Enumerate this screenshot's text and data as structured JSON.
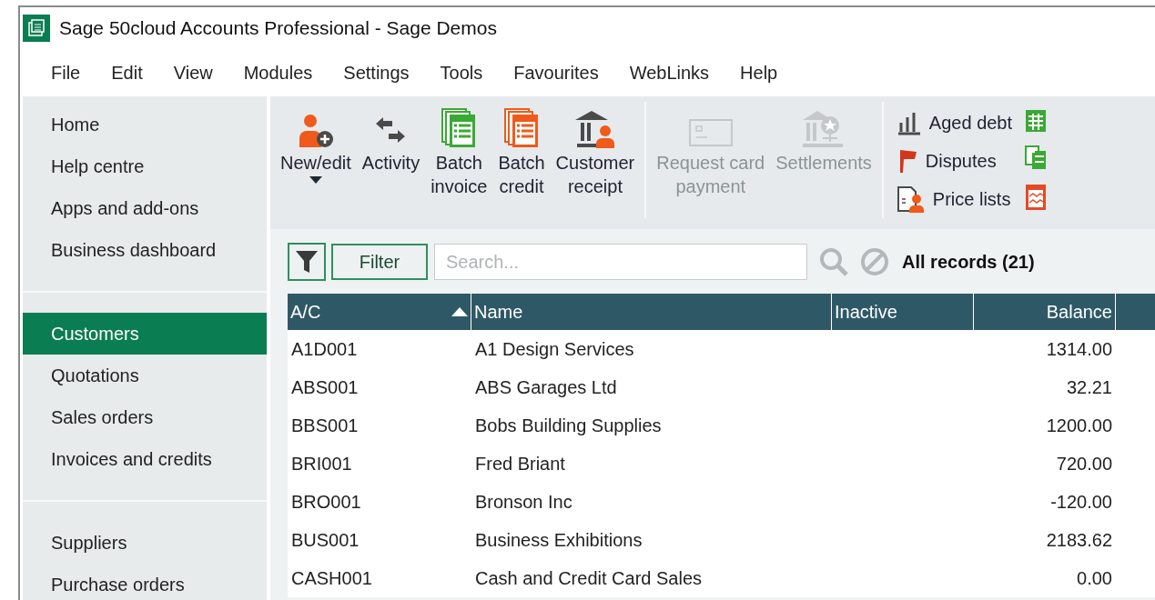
{
  "window": {
    "title": "Sage 50cloud Accounts Professional - Sage Demos"
  },
  "menu": [
    "File",
    "Edit",
    "View",
    "Modules",
    "Settings",
    "Tools",
    "Favourites",
    "WebLinks",
    "Help"
  ],
  "sidebar": {
    "groups": [
      {
        "items": [
          {
            "label": "Home",
            "selected": false
          },
          {
            "label": "Help centre",
            "selected": false
          },
          {
            "label": "Apps and add-ons",
            "selected": false
          },
          {
            "label": "Business dashboard",
            "selected": false
          }
        ]
      },
      {
        "items": [
          {
            "label": "Customers",
            "selected": true
          },
          {
            "label": "Quotations",
            "selected": false
          },
          {
            "label": "Sales orders",
            "selected": false
          },
          {
            "label": "Invoices and credits",
            "selected": false
          }
        ]
      },
      {
        "items": [
          {
            "label": "Suppliers",
            "selected": false
          },
          {
            "label": "Purchase orders",
            "selected": false
          }
        ]
      }
    ]
  },
  "toolbar": {
    "groups": [
      {
        "buttons": [
          {
            "label": "New/edit",
            "kind": "person-add",
            "dropdown": true,
            "disabled": false
          },
          {
            "label": "Activity",
            "kind": "arrows",
            "dropdown": false,
            "disabled": false
          },
          {
            "label": "Batch invoice",
            "kind": "green-docs",
            "dropdown": false,
            "disabled": false
          },
          {
            "label": "Batch credit",
            "kind": "orange-docs",
            "dropdown": false,
            "disabled": false
          },
          {
            "label": "Customer receipt",
            "kind": "bank-person",
            "dropdown": false,
            "disabled": false
          }
        ]
      },
      {
        "buttons": [
          {
            "label": "Request card payment",
            "kind": "card",
            "dropdown": false,
            "disabled": true
          },
          {
            "label": "Settlements",
            "kind": "bank-star",
            "dropdown": false,
            "disabled": true
          }
        ]
      }
    ],
    "links": [
      {
        "label": "Aged debt",
        "kind": "bars"
      },
      {
        "label": "Disputes",
        "kind": "flag"
      },
      {
        "label": "Price lists",
        "kind": "price"
      }
    ]
  },
  "filter": {
    "button": "Filter",
    "search_placeholder": "Search...",
    "record_count": "All records (21)"
  },
  "table": {
    "columns": [
      {
        "label": "A/C",
        "sorted": true
      },
      {
        "label": "Name",
        "sorted": false
      },
      {
        "label": "Inactive",
        "sorted": false
      },
      {
        "label": "Balance",
        "sorted": false
      }
    ],
    "rows": [
      {
        "ac": "A1D001",
        "name": "A1 Design Services",
        "balance": "1314.00"
      },
      {
        "ac": "ABS001",
        "name": "ABS Garages Ltd",
        "balance": "32.21"
      },
      {
        "ac": "BBS001",
        "name": "Bobs Building Supplies",
        "balance": "1200.00"
      },
      {
        "ac": "BRI001",
        "name": "Fred Briant",
        "balance": "720.00"
      },
      {
        "ac": "BRO001",
        "name": "Bronson Inc",
        "balance": "-120.00"
      },
      {
        "ac": "BUS001",
        "name": "Business Exhibitions",
        "balance": "2183.62"
      },
      {
        "ac": "CASH001",
        "name": "Cash and Credit Card Sales",
        "balance": "0.00"
      }
    ]
  }
}
